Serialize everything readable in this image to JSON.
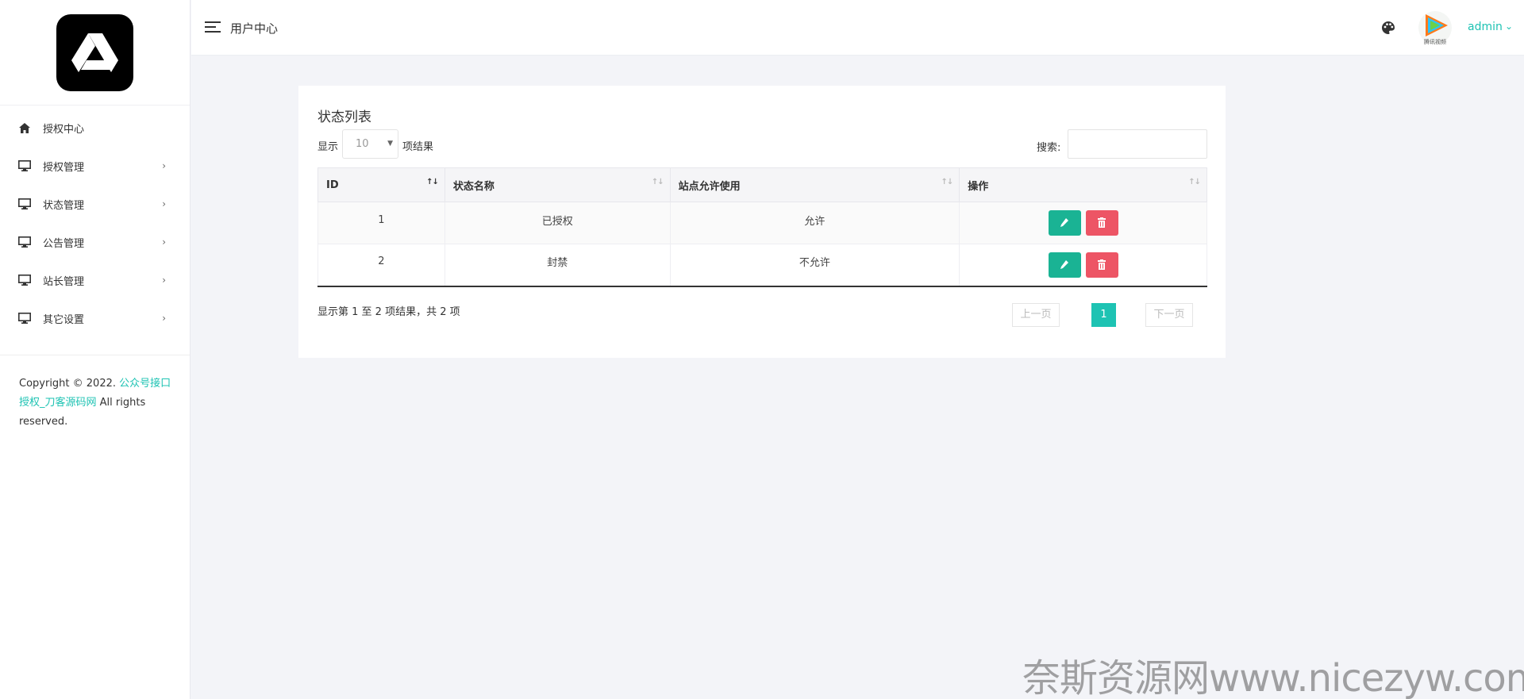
{
  "sidebar": {
    "items": [
      {
        "label": "授权中心",
        "icon": "home-icon"
      },
      {
        "label": "授权管理",
        "icon": "monitor-icon"
      },
      {
        "label": "状态管理",
        "icon": "monitor-icon"
      },
      {
        "label": "公告管理",
        "icon": "monitor-icon"
      },
      {
        "label": "站长管理",
        "icon": "monitor-icon"
      },
      {
        "label": "其它设置",
        "icon": "monitor-icon"
      }
    ],
    "copyright_prefix": "Copyright © 2022. ",
    "copyright_link": "公众号接口授权_刀客源码网",
    "copyright_suffix": " All rights reserved."
  },
  "header": {
    "title": "用户中心",
    "username": "admin",
    "avatar_caption": "腾讯视频"
  },
  "panel": {
    "title": "状态列表",
    "show_label": "显示",
    "page_size": "10",
    "show_suffix": "项结果",
    "search_label": "搜索:",
    "search_value": "",
    "columns": [
      "ID",
      "状态名称",
      "站点允许使用",
      "操作"
    ],
    "rows": [
      {
        "id": "1",
        "name": "已授权",
        "allowed": "允许"
      },
      {
        "id": "2",
        "name": "封禁",
        "allowed": "不允许"
      }
    ],
    "info": "显示第 1 至 2 项结果，共 2 项",
    "pagination": {
      "prev": "上一页",
      "current": "1",
      "next": "下一页"
    }
  },
  "watermark": "奈斯资源网www.nicezyw.com",
  "colors": {
    "accent": "#1ec3b3",
    "edit": "#1ab394",
    "delete": "#ed5565"
  }
}
